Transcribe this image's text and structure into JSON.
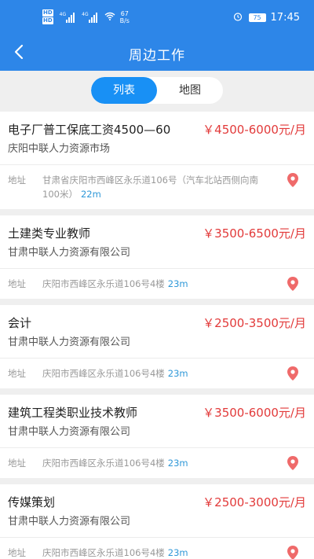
{
  "status": {
    "hd1": "HD",
    "hd2": "HD",
    "net1": "4G",
    "net2": "4G",
    "speed_value": "67",
    "speed_unit": "B/s",
    "battery": "75",
    "time": "17:45"
  },
  "nav": {
    "title": "周边工作"
  },
  "segment": {
    "list_label": "列表",
    "map_label": "地图",
    "active": "list"
  },
  "jobs": [
    {
      "title": "电子厂普工保底工资4500—60",
      "salary": "￥4500-6000元/月",
      "company": "庆阳中联人力资源市场",
      "addr_label": "地址",
      "address": "甘肃省庆阳市西峰区永乐道106号（汽车北站西侧向南100米）",
      "distance": "22m"
    },
    {
      "title": "土建类专业教师",
      "salary": "￥3500-6500元/月",
      "company": "甘肃中联人力资源有限公司",
      "addr_label": "地址",
      "address": "庆阳市西峰区永乐道106号4楼",
      "distance": "23m"
    },
    {
      "title": "会计",
      "salary": "￥2500-3500元/月",
      "company": "甘肃中联人力资源有限公司",
      "addr_label": "地址",
      "address": "庆阳市西峰区永乐道106号4楼",
      "distance": "23m"
    },
    {
      "title": "建筑工程类职业技术教师",
      "salary": "￥3500-6000元/月",
      "company": "甘肃中联人力资源有限公司",
      "addr_label": "地址",
      "address": "庆阳市西峰区永乐道106号4楼",
      "distance": "23m"
    },
    {
      "title": "传媒策划",
      "salary": "￥2500-3000元/月",
      "company": "甘肃中联人力资源有限公司",
      "addr_label": "地址",
      "address": "庆阳市西峰区永乐道106号4楼",
      "distance": "23m"
    }
  ],
  "colors": {
    "primary": "#2d86e8",
    "segment_active": "#1890f5",
    "salary": "#e23a3a",
    "distance": "#2f98d8",
    "pin": "#ef6a6a"
  },
  "icons": {
    "back": "chevron-left-icon",
    "pin": "map-pin-icon",
    "wifi": "wifi-icon",
    "alarm": "alarm-clock-icon",
    "battery": "battery-icon",
    "signal": "signal-icon"
  }
}
